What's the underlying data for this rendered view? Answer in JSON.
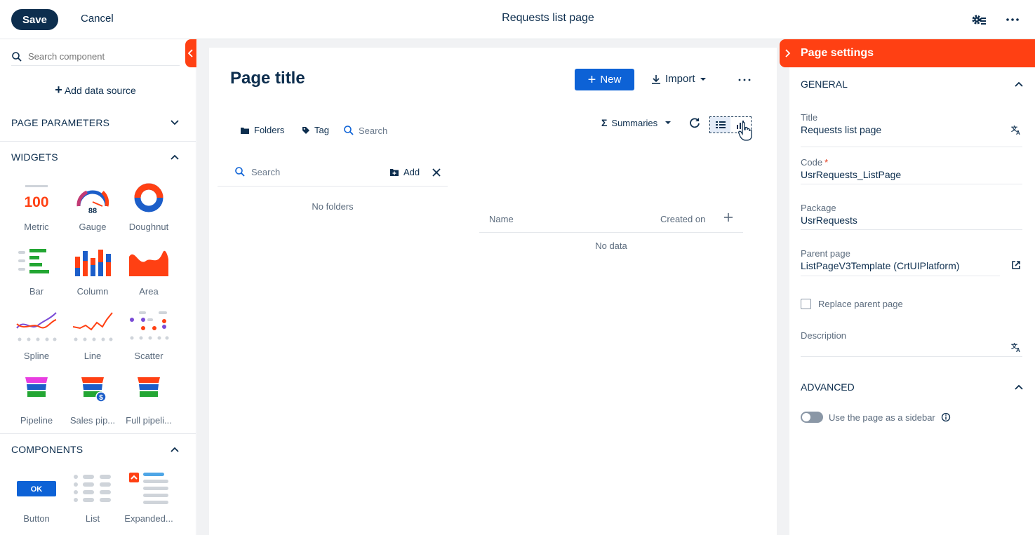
{
  "topbar": {
    "save_label": "Save",
    "cancel_label": "Cancel",
    "title": "Requests list page"
  },
  "left_panel": {
    "search_placeholder": "Search component",
    "add_data_source": "Add data source",
    "sections": {
      "page_parameters": "PAGE PARAMETERS",
      "widgets": "WIDGETS",
      "components": "COMPONENTS"
    },
    "widgets": [
      {
        "label": "Metric",
        "icon": "metric-icon",
        "text": "100"
      },
      {
        "label": "Gauge",
        "icon": "gauge-icon",
        "text": "88"
      },
      {
        "label": "Doughnut",
        "icon": "doughnut-icon"
      },
      {
        "label": "Bar",
        "icon": "bar-chart-icon"
      },
      {
        "label": "Column",
        "icon": "column-chart-icon"
      },
      {
        "label": "Area",
        "icon": "area-chart-icon"
      },
      {
        "label": "Spline",
        "icon": "spline-chart-icon"
      },
      {
        "label": "Line",
        "icon": "line-chart-icon"
      },
      {
        "label": "Scatter",
        "icon": "scatter-chart-icon"
      },
      {
        "label": "Pipeline",
        "icon": "pipeline-icon"
      },
      {
        "label": "Sales pip...",
        "icon": "sales-pipeline-icon",
        "text": "$"
      },
      {
        "label": "Full pipeli...",
        "icon": "full-pipeline-icon"
      }
    ],
    "components": [
      {
        "label": "Button",
        "icon": "button-component-icon",
        "text": "OK"
      },
      {
        "label": "List",
        "icon": "list-component-icon"
      },
      {
        "label": "Expanded...",
        "icon": "expanded-list-icon"
      }
    ]
  },
  "canvas": {
    "page_title": "Page title",
    "new_label": "New",
    "import_label": "Import",
    "folders_label": "Folders",
    "tag_label": "Tag",
    "search_label": "Search",
    "summaries_label": "Summaries",
    "folder_search_placeholder": "Search",
    "folder_add_label": "Add",
    "no_folders": "No folders",
    "columns": [
      "Name",
      "Created on"
    ],
    "no_data": "No data"
  },
  "right_panel": {
    "header": "Page settings",
    "general": "GENERAL",
    "fields": [
      {
        "label": "Title",
        "value": "Requests list page",
        "required": false
      },
      {
        "label": "Code",
        "value": "UsrRequests_ListPage",
        "required": true
      },
      {
        "label": "Package",
        "value": "UsrRequests",
        "required": false
      },
      {
        "label": "Parent page",
        "value": "ListPageV3Template (CrtUIPlatform)",
        "required": false
      }
    ],
    "replace_parent_page": "Replace parent page",
    "description_label": "Description",
    "advanced": "ADVANCED",
    "sidebar_toggle_label": "Use the page as a sidebar",
    "sidebar_toggle_on": false
  },
  "colors": {
    "accent_orange": "#ff4013",
    "primary_blue": "#0d62d6",
    "navy": "#0d2e4e"
  }
}
